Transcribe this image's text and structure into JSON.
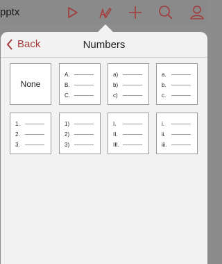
{
  "toolbar": {
    "filename": "pptx",
    "icons": [
      "play-icon",
      "pen-icon",
      "add-icon",
      "search-icon",
      "user-icon"
    ]
  },
  "popover": {
    "back_label": "Back",
    "title": "Numbers"
  },
  "styles": [
    {
      "name": "none",
      "label": "None"
    },
    {
      "name": "upper-letter-period",
      "markers": [
        "A.",
        "B.",
        "C."
      ]
    },
    {
      "name": "lower-letter-paren",
      "markers": [
        "a)",
        "b)",
        "c)"
      ]
    },
    {
      "name": "lower-letter-period",
      "markers": [
        "a.",
        "b.",
        "c."
      ]
    },
    {
      "name": "number-period",
      "markers": [
        "1.",
        "2.",
        "3."
      ]
    },
    {
      "name": "number-paren",
      "markers": [
        "1)",
        "2)",
        "3)"
      ]
    },
    {
      "name": "upper-roman-period",
      "markers": [
        "I.",
        "II.",
        "III."
      ]
    },
    {
      "name": "lower-roman-period",
      "markers": [
        "i.",
        "ii.",
        "iii."
      ]
    }
  ],
  "colors": {
    "accent": "#a33b3b",
    "toolbar_bg": "#8a8a8a",
    "popover_bg": "#f2f2f2"
  }
}
